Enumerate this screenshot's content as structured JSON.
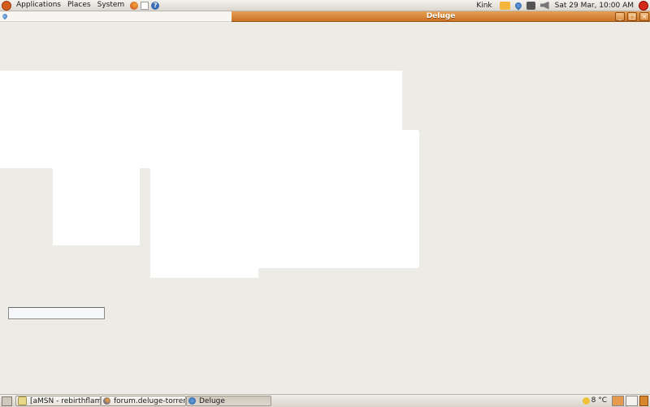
{
  "top_panel": {
    "menus": [
      "Applications",
      "Places",
      "System"
    ],
    "launchers": [
      "firefox-icon",
      "home-icon",
      "help-icon"
    ],
    "user": "Kink",
    "clock": "Sat 29 Mar, 10:00 AM"
  },
  "window": {
    "title": "Deluge",
    "buttons": [
      "_",
      "□",
      "×"
    ]
  },
  "taskbar": {
    "tasks": [
      {
        "label": "[aMSN - rebirthflame...",
        "icon": "amsn-icon"
      },
      {
        "label": "forum.deluge-torrent....",
        "icon": "firefox-icon"
      },
      {
        "label": "Deluge",
        "icon": "deluge-icon",
        "active": true
      }
    ],
    "temperature": "8 °C"
  },
  "colors": {
    "titlebar": "#c97224",
    "desktop": "#edebe6"
  }
}
